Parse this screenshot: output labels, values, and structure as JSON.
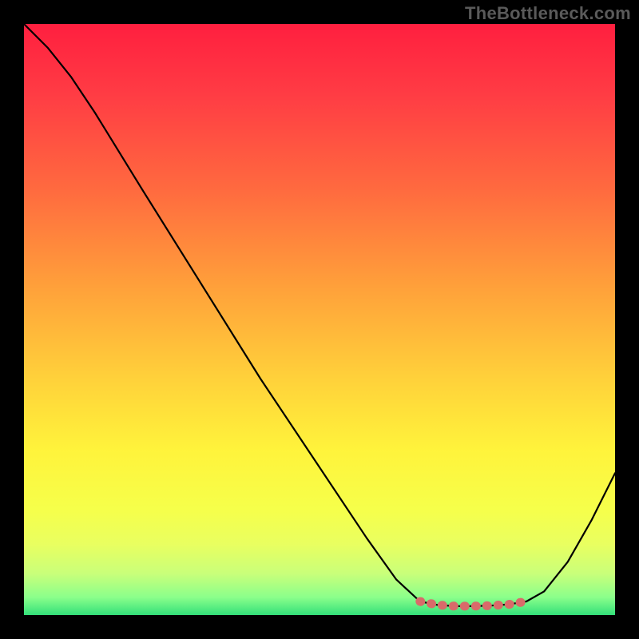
{
  "watermark": "TheBottleneck.com",
  "chart_data": {
    "type": "line",
    "title": "",
    "xlabel": "",
    "ylabel": "",
    "xlim": [
      0,
      100
    ],
    "ylim": [
      0,
      100
    ],
    "curve": [
      {
        "x": 0,
        "y": 100
      },
      {
        "x": 4,
        "y": 96
      },
      {
        "x": 8,
        "y": 91
      },
      {
        "x": 12,
        "y": 85
      },
      {
        "x": 20,
        "y": 72
      },
      {
        "x": 30,
        "y": 56
      },
      {
        "x": 40,
        "y": 40
      },
      {
        "x": 50,
        "y": 25
      },
      {
        "x": 58,
        "y": 13
      },
      {
        "x": 63,
        "y": 6
      },
      {
        "x": 67,
        "y": 2.3
      },
      {
        "x": 70,
        "y": 1.7
      },
      {
        "x": 73,
        "y": 1.5
      },
      {
        "x": 76,
        "y": 1.5
      },
      {
        "x": 79,
        "y": 1.6
      },
      {
        "x": 82,
        "y": 1.8
      },
      {
        "x": 85,
        "y": 2.3
      },
      {
        "x": 88,
        "y": 4
      },
      {
        "x": 92,
        "y": 9
      },
      {
        "x": 96,
        "y": 16
      },
      {
        "x": 100,
        "y": 24
      }
    ],
    "highlight_segment": [
      {
        "x": 67,
        "y": 2.3
      },
      {
        "x": 70,
        "y": 1.7
      },
      {
        "x": 73,
        "y": 1.5
      },
      {
        "x": 76,
        "y": 1.5
      },
      {
        "x": 79,
        "y": 1.6
      },
      {
        "x": 82,
        "y": 1.8
      },
      {
        "x": 85,
        "y": 2.3
      }
    ],
    "gradient_stops": [
      {
        "offset": 0.0,
        "color": "#ff1f3f"
      },
      {
        "offset": 0.12,
        "color": "#ff3c44"
      },
      {
        "offset": 0.28,
        "color": "#ff6a3f"
      },
      {
        "offset": 0.45,
        "color": "#ffa23a"
      },
      {
        "offset": 0.6,
        "color": "#ffd13a"
      },
      {
        "offset": 0.72,
        "color": "#fff33b"
      },
      {
        "offset": 0.82,
        "color": "#f6ff4a"
      },
      {
        "offset": 0.88,
        "color": "#e9ff60"
      },
      {
        "offset": 0.93,
        "color": "#c9ff7a"
      },
      {
        "offset": 0.97,
        "color": "#8bff8b"
      },
      {
        "offset": 1.0,
        "color": "#33e07a"
      }
    ],
    "highlight_color": "#d96a6a",
    "curve_color": "#000000"
  }
}
